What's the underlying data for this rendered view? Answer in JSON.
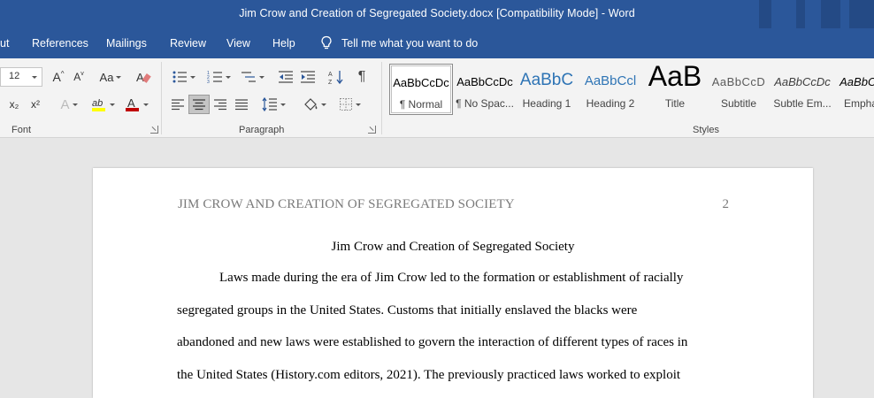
{
  "window": {
    "title": "Jim Crow and Creation of Segregated Society.docx [Compatibility Mode]  -  Word"
  },
  "tabs": [
    "ut",
    "References",
    "Mailings",
    "Review",
    "View",
    "Help"
  ],
  "tell_me": "Tell me what you want to do",
  "font_group": {
    "font_size": "12",
    "label": "Font",
    "grow_font": "A",
    "shrink_font": "A",
    "change_case": "Aa",
    "subscript": "x₂",
    "superscript": "x²",
    "text_effects": "A",
    "font_color": "A",
    "font_color_hex": "#c00000",
    "highlight_color_hex": "#ffff00"
  },
  "paragraph_group": {
    "label": "Paragraph",
    "pilcrow": "¶"
  },
  "styles_group": {
    "label": "Styles",
    "items": [
      {
        "preview": "AaBbCcDc",
        "name": "¶ Normal"
      },
      {
        "preview": "AaBbCcDc",
        "name": "¶ No Spac..."
      },
      {
        "preview": "AaBbC",
        "name": "Heading 1"
      },
      {
        "preview": "AaBbCcl",
        "name": "Heading 2"
      },
      {
        "preview": "AaB",
        "name": "Title"
      },
      {
        "preview": "AaBbCcD",
        "name": "Subtitle"
      },
      {
        "preview": "AaBbCcDc",
        "name": "Subtle Em..."
      },
      {
        "preview": "AaBbCc",
        "name": "Empha"
      }
    ]
  },
  "document": {
    "running_head": "JIM CROW AND CREATION OF SEGREGATED SOCIETY",
    "page_number": "2",
    "title": "Jim Crow and Creation of Segregated Society",
    "lines": [
      "Laws made during the era of Jim Crow led to the formation or establishment of racially",
      "segregated groups in the United States. Customs that initially enslaved the blacks were",
      "abandoned and new laws were established to govern the interaction of different types of races in",
      "the United States (History.com editors, 2021). The previously practiced laws worked to exploit"
    ]
  }
}
